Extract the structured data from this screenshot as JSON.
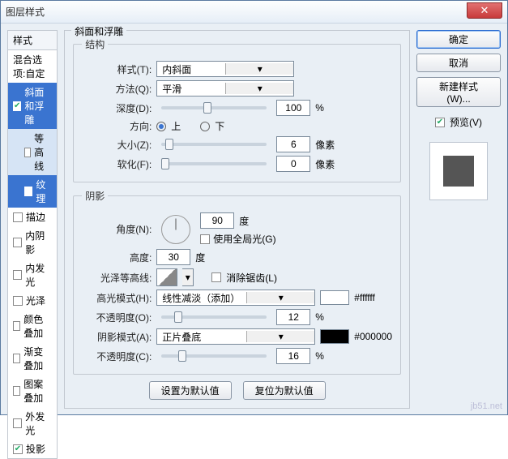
{
  "window": {
    "title": "图层样式"
  },
  "sidebar": {
    "header": "样式",
    "blend": "混合选项:自定",
    "items": [
      {
        "label": "斜面和浮雕",
        "checked": true,
        "selected": true,
        "child": false
      },
      {
        "label": "等高线",
        "checked": false,
        "selected": false,
        "child": true
      },
      {
        "label": "纹理",
        "checked": false,
        "selected": true,
        "child": true
      },
      {
        "label": "描边",
        "checked": false,
        "selected": false,
        "child": false
      },
      {
        "label": "内阴影",
        "checked": false,
        "selected": false,
        "child": false
      },
      {
        "label": "内发光",
        "checked": false,
        "selected": false,
        "child": false
      },
      {
        "label": "光泽",
        "checked": false,
        "selected": false,
        "child": false
      },
      {
        "label": "颜色叠加",
        "checked": false,
        "selected": false,
        "child": false
      },
      {
        "label": "渐变叠加",
        "checked": false,
        "selected": false,
        "child": false
      },
      {
        "label": "图案叠加",
        "checked": false,
        "selected": false,
        "child": false
      },
      {
        "label": "外发光",
        "checked": false,
        "selected": false,
        "child": false
      },
      {
        "label": "投影",
        "checked": true,
        "selected": false,
        "child": false
      }
    ]
  },
  "panel": {
    "title": "斜面和浮雕",
    "structure": {
      "legend": "结构",
      "style_label": "样式(T):",
      "style_value": "内斜面",
      "tech_label": "方法(Q):",
      "tech_value": "平滑",
      "depth_label": "深度(D):",
      "depth_value": "100",
      "depth_unit": "%",
      "direction_label": "方向:",
      "dir_up": "上",
      "dir_down": "下",
      "size_label": "大小(Z):",
      "size_value": "6",
      "size_unit": "像素",
      "soften_label": "软化(F):",
      "soften_value": "0",
      "soften_unit": "像素"
    },
    "shading": {
      "legend": "阴影",
      "angle_label": "角度(N):",
      "angle_value": "90",
      "angle_unit": "度",
      "use_global": "使用全局光(G)",
      "altitude_label": "高度:",
      "altitude_value": "30",
      "altitude_unit": "度",
      "gloss_label": "光泽等高线:",
      "antialias": "消除锯齿(L)",
      "highlight_mode_label": "高光模式(H):",
      "highlight_mode_value": "线性减淡（添加）",
      "highlight_color": "#ffffff",
      "highlight_color_text": "#ffffff",
      "highlight_opacity_label": "不透明度(O):",
      "highlight_opacity_value": "12",
      "pct": "%",
      "shadow_mode_label": "阴影模式(A):",
      "shadow_mode_value": "正片叠底",
      "shadow_color": "#000000",
      "shadow_color_text": "#000000",
      "shadow_opacity_label": "不透明度(C):",
      "shadow_opacity_value": "16"
    },
    "footer": {
      "make_default": "设置为默认值",
      "reset_default": "复位为默认值"
    }
  },
  "right": {
    "ok": "确定",
    "cancel": "取消",
    "new_style": "新建样式(W)...",
    "preview_label": "预览(V)",
    "preview_checked": true
  },
  "watermark": "jb51.net"
}
